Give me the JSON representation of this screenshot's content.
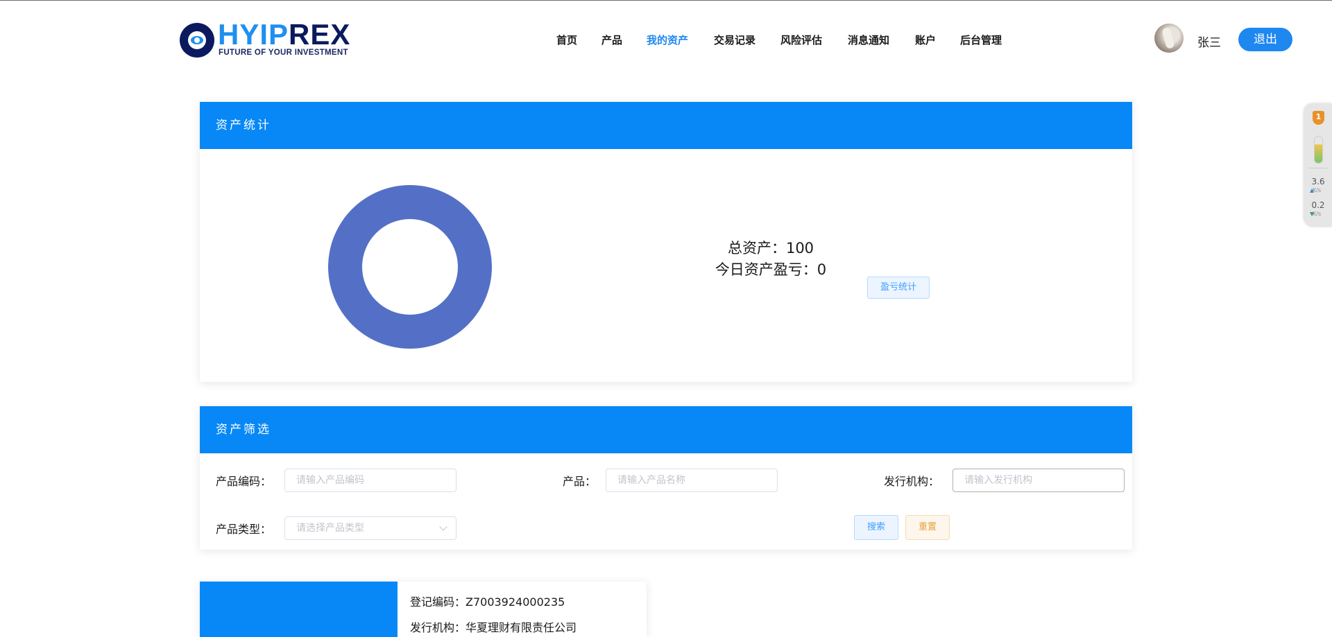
{
  "brand": {
    "logo_text_blue": "HYIP",
    "logo_text_navy": "REX",
    "tagline": "FUTURE OF YOUR INVESTMENT"
  },
  "nav": {
    "items": [
      {
        "label": "首页",
        "active": false
      },
      {
        "label": "产品",
        "active": false
      },
      {
        "label": "我的资产",
        "active": true
      },
      {
        "label": "交易记录",
        "active": false
      },
      {
        "label": "风险评估",
        "active": false
      },
      {
        "label": "消息通知",
        "active": false
      },
      {
        "label": "账户",
        "active": false
      },
      {
        "label": "后台管理",
        "active": false
      }
    ]
  },
  "user": {
    "name": "张三",
    "logout_label": "退出"
  },
  "widget": {
    "badge": "1",
    "upload_speed": "3.6",
    "download_speed": "0.2",
    "unit": "K/s"
  },
  "asset_stats": {
    "title": "资产统计",
    "total_label": "总资产：100",
    "today_label": "今日资产盈亏：0",
    "profit_button": "盈亏统计"
  },
  "chart_data": {
    "type": "pie",
    "style": "donut",
    "values": [
      100
    ],
    "colors": [
      "#5470c6"
    ]
  },
  "filter": {
    "title": "资产筛选",
    "code_label": "产品编码：",
    "code_placeholder": "请输入产品编码",
    "product_label": "产品：",
    "product_placeholder": "请输入产品名称",
    "issuer_label": "发行机构：",
    "issuer_placeholder": "请输入发行机构",
    "type_label": "产品类型：",
    "type_placeholder": "请选择产品类型",
    "search_button": "搜索",
    "reset_button": "重置"
  },
  "asset_item": {
    "reg_code": "登记编码：Z7003924000235",
    "issuer": "发行机构：华夏理财有限责任公司"
  },
  "colors": {
    "primary": "#0888f7",
    "nav_active": "#1e87f0",
    "donut": "#5470c6"
  }
}
